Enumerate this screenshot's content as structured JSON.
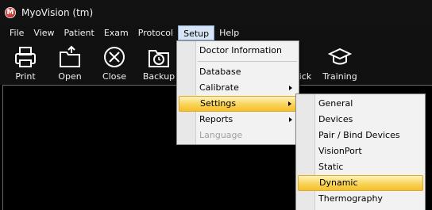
{
  "window": {
    "title": "MyoVision (tm)",
    "icon_glyph": "M"
  },
  "menubar": [
    "File",
    "View",
    "Patient",
    "Exam",
    "Protocol",
    "Setup",
    "Help"
  ],
  "toolbar": {
    "print": "Print",
    "open": "Open",
    "close": "Close",
    "backup": "Backup",
    "quick": "uick",
    "training": "Training"
  },
  "setup_menu": {
    "doctor_information": "Doctor Information",
    "database": "Database",
    "calibrate": "Calibrate",
    "settings": "Settings",
    "reports": "Reports",
    "language": "Language"
  },
  "settings_submenu": [
    "General",
    "Devices",
    "Pair / Bind Devices",
    "VisionPort",
    "Static",
    "Dynamic",
    "Thermography"
  ],
  "colors": {
    "highlight": "#f9d35a",
    "active_menu": "#d6e4f6",
    "menu_bg": "#f2f2f2"
  }
}
